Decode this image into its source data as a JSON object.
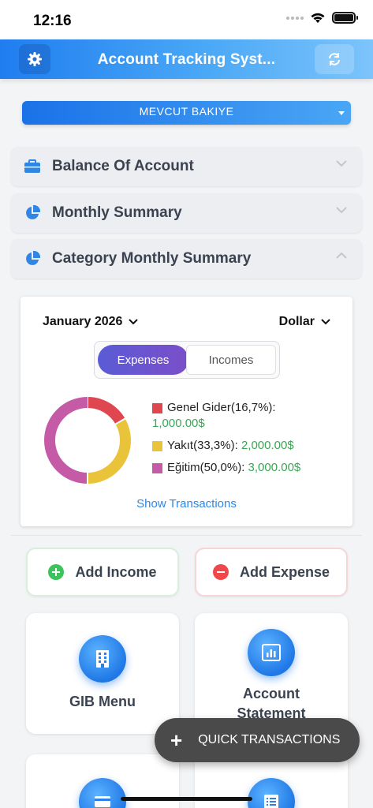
{
  "status_bar": {
    "time": "12:16"
  },
  "header": {
    "title": "Account Tracking Syst...",
    "settings_icon": "gear-icon",
    "refresh_icon": "refresh-icon"
  },
  "balance_dropdown": {
    "label": "MEVCUT BAKIYE"
  },
  "accordions": [
    {
      "label": "Balance Of Account",
      "icon": "briefcase-icon",
      "expanded": false
    },
    {
      "label": "Monthly Summary",
      "icon": "pie-chart-icon",
      "expanded": false
    },
    {
      "label": "Category Monthly Summary",
      "icon": "pie-chart-icon",
      "expanded": true
    }
  ],
  "category_summary": {
    "month": "January 2026",
    "currency": "Dollar",
    "tabs": [
      "Expenses",
      "Incomes"
    ],
    "active_tab": "Expenses",
    "show_transactions": "Show Transactions"
  },
  "chart_data": {
    "type": "pie",
    "categories": [
      "Genel Gider",
      "Yakıt",
      "Eğitim"
    ],
    "values": [
      1000,
      2000,
      3000
    ],
    "percent_labels": [
      "16,7%",
      "33,3%",
      "50,0%"
    ],
    "amount_labels": [
      "1,000.00$",
      "2,000.00$",
      "3,000.00$"
    ],
    "legend_text": [
      "Genel Gider(16,7%):",
      "Yakıt(33,3%):",
      "Eğitim(50,0%):"
    ],
    "colors": [
      "#e0464f",
      "#e9c43b",
      "#c55aa6"
    ],
    "legend": "right"
  },
  "actions": {
    "add_income": "Add Income",
    "add_expense": "Add Expense"
  },
  "menu": {
    "gib": "GIB Menu",
    "statement_line1": "Account",
    "statement_line2": "Statement"
  },
  "fab": {
    "label": "QUICK TRANSACTIONS"
  }
}
